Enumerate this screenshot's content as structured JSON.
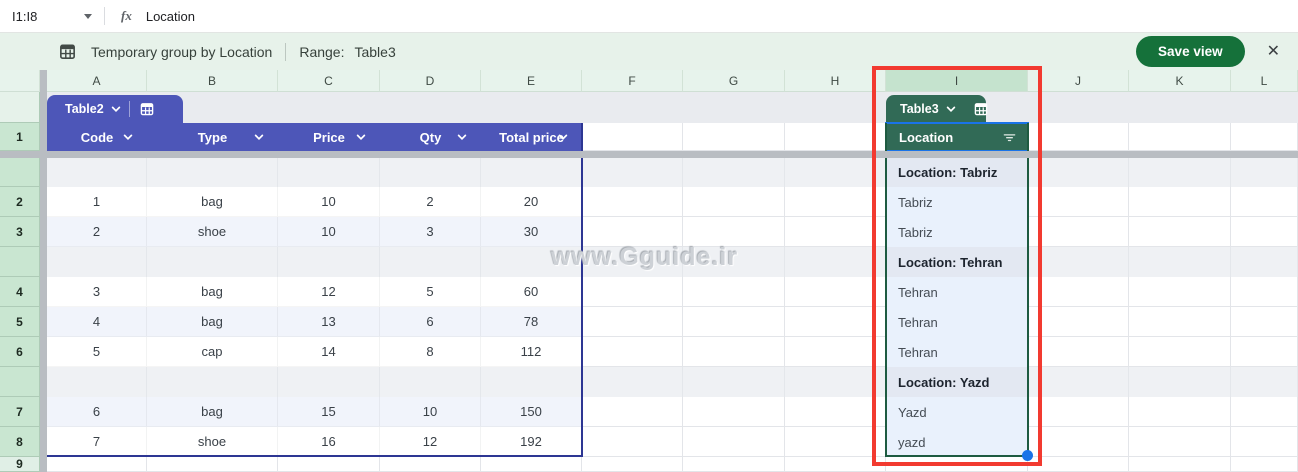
{
  "formula_bar": {
    "name_box": "I1:I8",
    "formula": "Location"
  },
  "toolbar": {
    "title": "Temporary group by Location",
    "range_label": "Range:",
    "range_value": "Table3",
    "save_button": "Save view",
    "close": "✕"
  },
  "grid": {
    "column_letters": [
      "A",
      "B",
      "C",
      "D",
      "E",
      "F",
      "G",
      "H",
      "I",
      "J",
      "K",
      "L"
    ],
    "selected_column": "I",
    "row_numbers": [
      "1",
      "2",
      "3",
      "4",
      "5",
      "6",
      "7",
      "8",
      "9"
    ],
    "selected_rows": [
      "1",
      "2",
      "3",
      "4",
      "5",
      "6",
      "7",
      "8"
    ]
  },
  "table2": {
    "tab_label": "Table2",
    "headers": [
      "Code",
      "Type",
      "Price",
      "Qty",
      "Total price"
    ],
    "rows": [
      [
        "1",
        "bag",
        "10",
        "2",
        "20"
      ],
      [
        "2",
        "shoe",
        "10",
        "3",
        "30"
      ],
      [
        "3",
        "bag",
        "12",
        "5",
        "60"
      ],
      [
        "4",
        "bag",
        "13",
        "6",
        "78"
      ],
      [
        "5",
        "cap",
        "14",
        "8",
        "112"
      ],
      [
        "6",
        "bag",
        "15",
        "10",
        "150"
      ],
      [
        "7",
        "shoe",
        "16",
        "12",
        "192"
      ]
    ],
    "accent_color": "#4d56b8",
    "border_color": "#2d3693"
  },
  "table3": {
    "tab_label": "Table3",
    "header": "Location",
    "groups": [
      {
        "label": "Location: Tabriz",
        "values": [
          "Tabriz",
          "Tabriz"
        ]
      },
      {
        "label": "Location: Tehran",
        "values": [
          "Tehran",
          "Tehran",
          "Tehran"
        ]
      },
      {
        "label": "Location: Yazd",
        "values": [
          "Yazd",
          "yazd"
        ]
      }
    ],
    "accent_color": "#316a56",
    "border_color": "#1e5b41"
  },
  "annotations": {
    "watermark": "www.Gguide.ir",
    "highlight_box_color": "#f23a30"
  },
  "colors": {
    "selection_blue": "#1a73e8",
    "save_green": "#15713a",
    "toolbar_bg": "#e7f2ea"
  }
}
